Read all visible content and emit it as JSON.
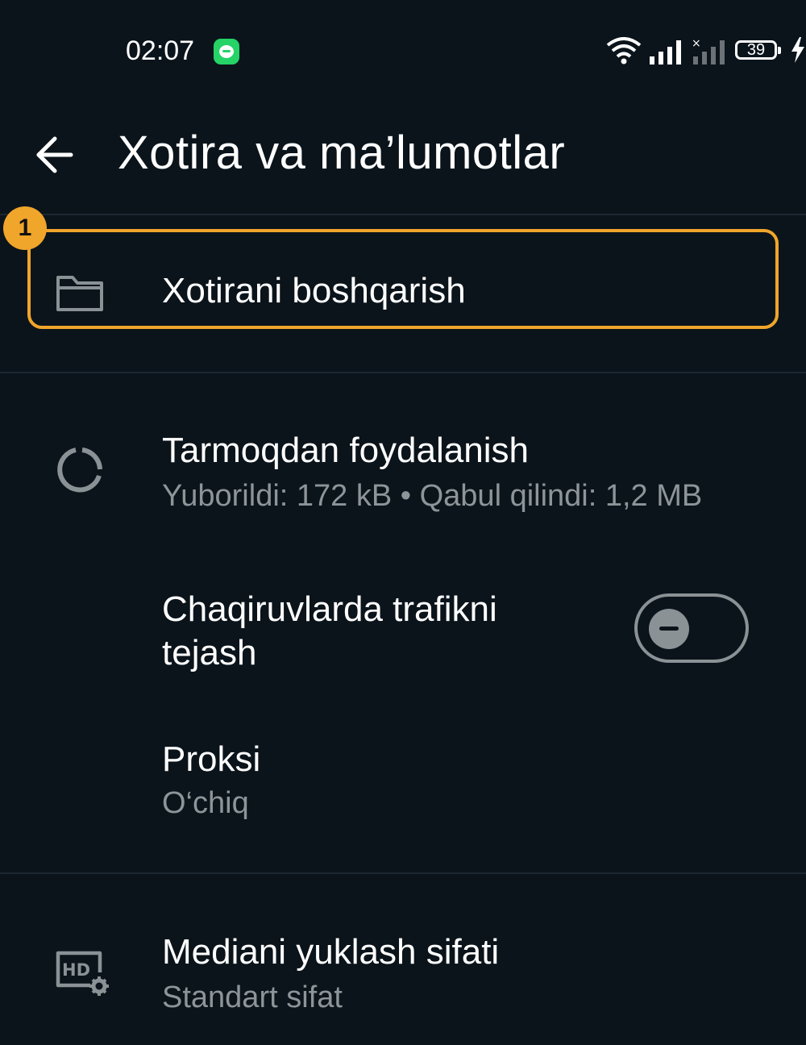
{
  "status_bar": {
    "time": "02:07",
    "battery": "39",
    "icons": [
      "whatsapp-notification-icon",
      "wifi-icon",
      "signal-icon",
      "signal-no-service-icon",
      "battery-icon",
      "charging-icon"
    ]
  },
  "header": {
    "title": "Xotira va ma’lumotlar",
    "back_icon": "arrow-left-icon"
  },
  "annotation": {
    "badge": "1",
    "color": "#f0a52b"
  },
  "items": {
    "storage": {
      "label": "Xotirani boshqarish",
      "icon": "folder-icon"
    },
    "network": {
      "label": "Tarmoqdan foydalanish",
      "sub": "Yuborildi: 172 kB • Qabul qilindi: 1,2 MB",
      "icon": "data-usage-icon"
    },
    "calls": {
      "label_line1": "Chaqiruvlarda trafikni",
      "label_line2": "tejash",
      "toggle_state": "off"
    },
    "proxy": {
      "label": "Proksi",
      "sub": "O‘chiq"
    },
    "media": {
      "label": "Mediani yuklash sifati",
      "sub": "Standart sifat",
      "icon": "hd-settings-icon"
    }
  },
  "colors": {
    "background": "#0b141b",
    "secondary_text": "#8d9599",
    "accent": "#f0a52b"
  }
}
